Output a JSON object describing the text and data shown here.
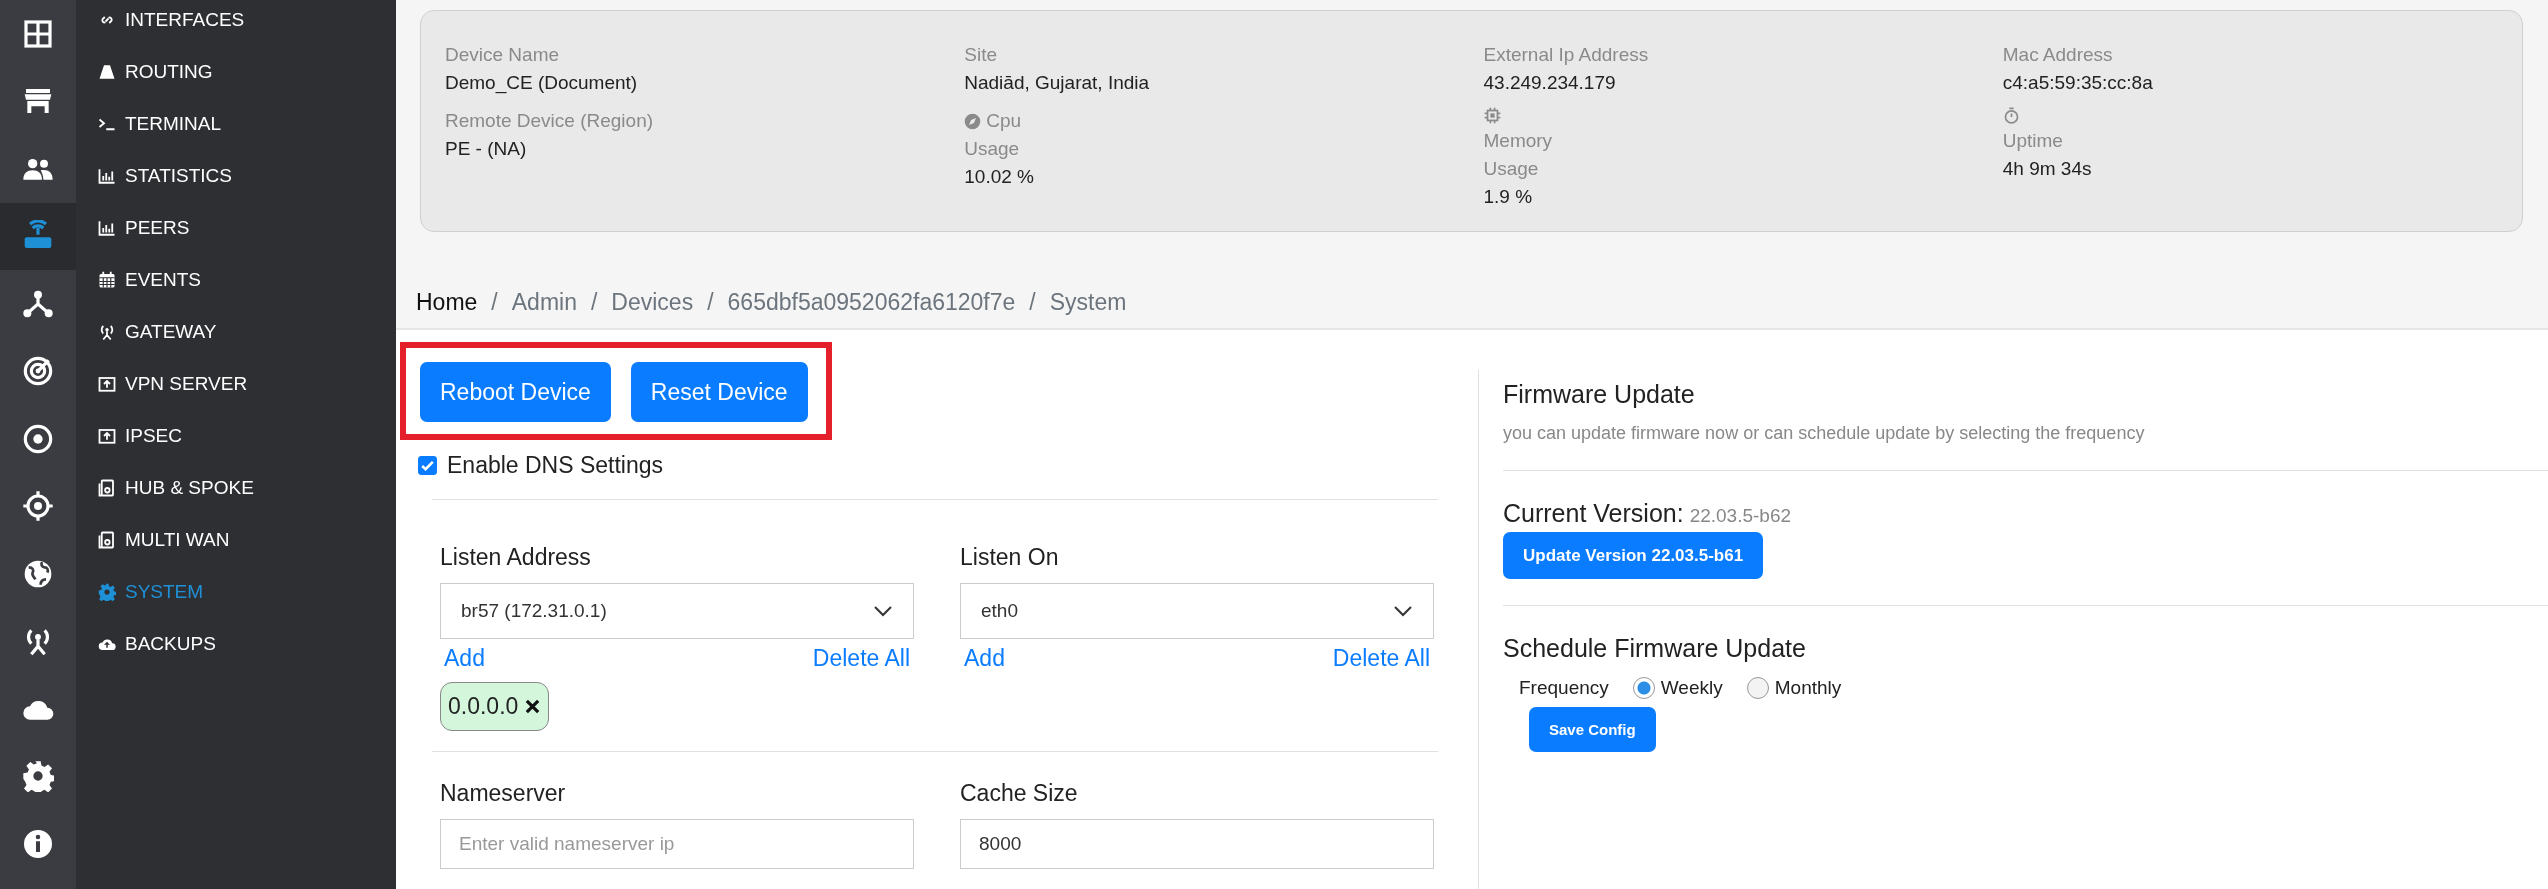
{
  "icon_rail": [
    {
      "selected": false
    },
    {
      "selected": false
    },
    {
      "selected": false
    },
    {
      "selected": true
    },
    {
      "selected": false
    },
    {
      "selected": false
    },
    {
      "selected": false
    },
    {
      "selected": false
    },
    {
      "selected": false
    },
    {
      "selected": false
    },
    {
      "selected": false
    },
    {
      "selected": false
    },
    {
      "selected": false
    }
  ],
  "submenu": [
    {
      "label": "INTERFACES",
      "selected": false
    },
    {
      "label": "ROUTING",
      "selected": false
    },
    {
      "label": "TERMINAL",
      "selected": false
    },
    {
      "label": "STATISTICS",
      "selected": false
    },
    {
      "label": "PEERS",
      "selected": false
    },
    {
      "label": "EVENTS",
      "selected": false
    },
    {
      "label": "GATEWAY",
      "selected": false
    },
    {
      "label": "VPN SERVER",
      "selected": false
    },
    {
      "label": "IPSEC",
      "selected": false
    },
    {
      "label": "HUB & SPOKE",
      "selected": false
    },
    {
      "label": "MULTI WAN",
      "selected": false
    },
    {
      "label": "SYSTEM",
      "selected": true
    },
    {
      "label": "BACKUPS",
      "selected": false
    }
  ],
  "device_info": [
    [
      {
        "labels": [
          "Device Name"
        ],
        "value": "Demo_CE (Document)"
      },
      {
        "labels": [
          "Remote Device (Region)"
        ],
        "value": "PE - (NA)"
      }
    ],
    [
      {
        "labels": [
          "Site"
        ],
        "value": "Nadiād, Gujarat, India"
      },
      {
        "labels": [
          "Cpu",
          "Usage"
        ],
        "value": "10.02 %"
      }
    ],
    [
      {
        "labels": [
          "External Ip Address"
        ],
        "value": "43.249.234.179"
      },
      {
        "labels": [
          "Memory",
          "Usage"
        ],
        "value": "1.9 %"
      }
    ],
    [
      {
        "labels": [
          "Mac Address"
        ],
        "value": "c4:a5:59:35:cc:8a"
      },
      {
        "labels": [
          "Uptime"
        ],
        "value": "4h 9m 34s"
      }
    ]
  ],
  "breadcrumb": {
    "separator": "/",
    "items": [
      "Home",
      "Admin",
      "Devices",
      "665dbf5a0952062fa6120f7e",
      "System"
    ]
  },
  "actions": {
    "highlighted": true,
    "buttons": [
      "Reboot Device",
      "Reset Device"
    ]
  },
  "dns": {
    "label": "Enable DNS Settings",
    "checked": true,
    "selects": [
      {
        "label": "Listen Address",
        "value": "br57 (172.31.0.1)",
        "add": "Add",
        "delete_all": "Delete All",
        "tags": [
          "0.0.0.0"
        ]
      },
      {
        "label": "Listen On",
        "value": "eth0",
        "add": "Add",
        "delete_all": "Delete All"
      }
    ],
    "inputs": [
      {
        "label": "Nameserver",
        "placeholder": "Enter valid nameserver ip"
      },
      {
        "label": "Cache Size",
        "value": "8000"
      }
    ]
  },
  "firmware": {
    "title": "Firmware Update",
    "description": "you can update firmware now or can schedule update by selecting the frequency",
    "current_label": "Current Version:",
    "current_value": "22.03.5-b62",
    "update_button": "Update Version 22.03.5-b61",
    "schedule_title": "Schedule Firmware Update",
    "frequency_label": "Frequency",
    "options": [
      {
        "label": "Weekly",
        "selected": true
      },
      {
        "label": "Monthly",
        "selected": false
      }
    ],
    "save_button": "Save Config"
  }
}
